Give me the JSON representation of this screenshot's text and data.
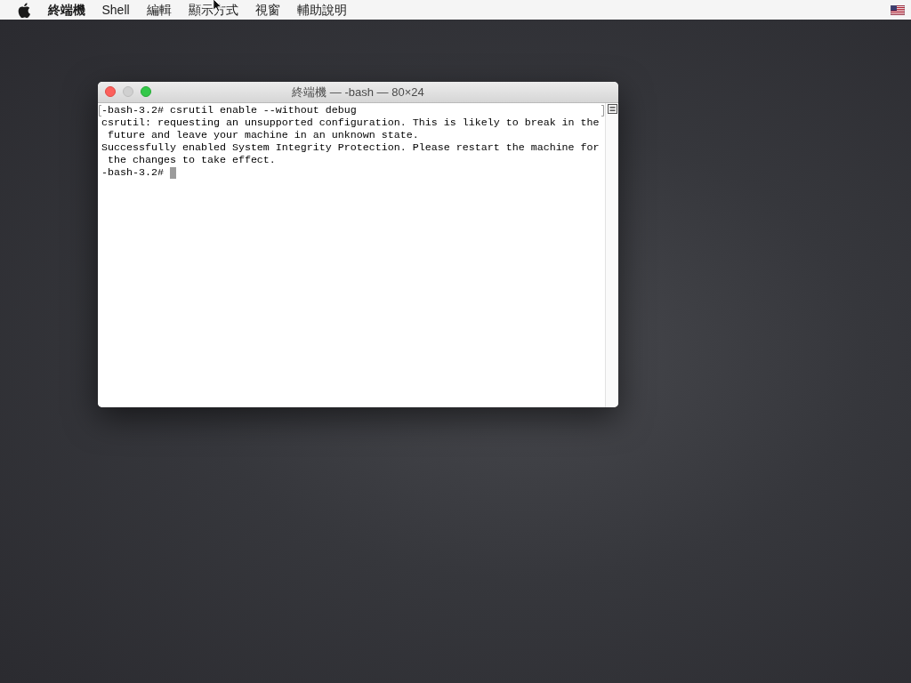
{
  "menu_bar": {
    "app_name": "終端機",
    "menus": [
      "Shell",
      "編輯",
      "顯示方式",
      "視窗",
      "輔助說明"
    ]
  },
  "window": {
    "title": "終端機 — -bash — 80×24",
    "buttons": [
      {
        "kind": "close",
        "disabled": false
      },
      {
        "kind": "minimize",
        "disabled": true
      },
      {
        "kind": "zoom",
        "disabled": false
      }
    ],
    "lines": [
      {
        "text": "-bash-3.2# csrutil enable --without debug",
        "marked": true,
        "cursor": false
      },
      {
        "text": "csrutil: requesting an unsupported configuration. This is likely to break in the",
        "marked": false,
        "cursor": false
      },
      {
        "text": " future and leave your machine in an unknown state.",
        "marked": false,
        "cursor": false
      },
      {
        "text": "Successfully enabled System Integrity Protection. Please restart the machine for",
        "marked": false,
        "cursor": false
      },
      {
        "text": " the changes to take effect.",
        "marked": false,
        "cursor": false
      },
      {
        "text": "-bash-3.2# ",
        "marked": false,
        "cursor": true
      }
    ]
  }
}
